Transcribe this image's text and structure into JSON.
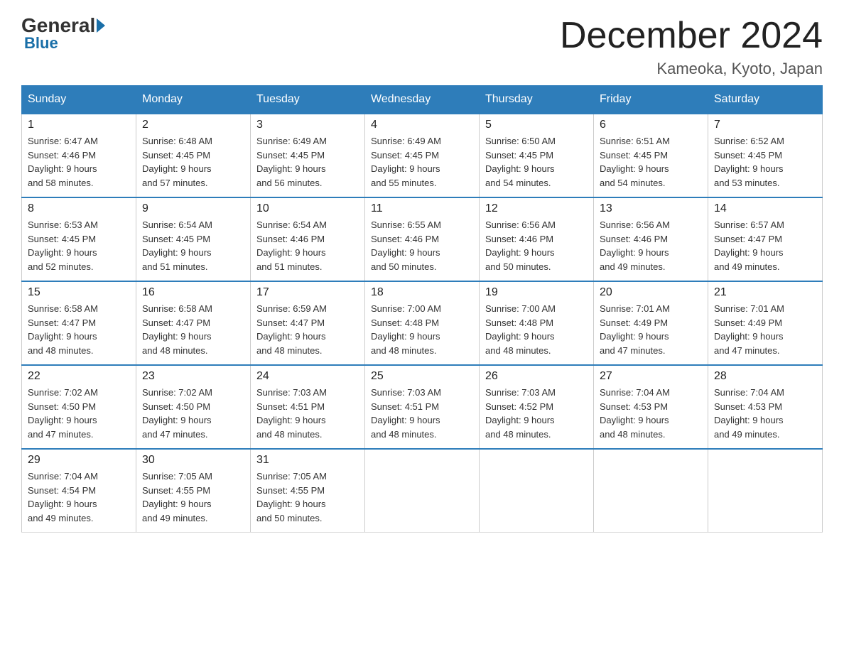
{
  "logo": {
    "general": "General",
    "blue": "Blue"
  },
  "title": "December 2024",
  "location": "Kameoka, Kyoto, Japan",
  "days_of_week": [
    "Sunday",
    "Monday",
    "Tuesday",
    "Wednesday",
    "Thursday",
    "Friday",
    "Saturday"
  ],
  "weeks": [
    [
      {
        "day": "1",
        "sunrise": "6:47 AM",
        "sunset": "4:46 PM",
        "daylight": "9 hours and 58 minutes."
      },
      {
        "day": "2",
        "sunrise": "6:48 AM",
        "sunset": "4:45 PM",
        "daylight": "9 hours and 57 minutes."
      },
      {
        "day": "3",
        "sunrise": "6:49 AM",
        "sunset": "4:45 PM",
        "daylight": "9 hours and 56 minutes."
      },
      {
        "day": "4",
        "sunrise": "6:49 AM",
        "sunset": "4:45 PM",
        "daylight": "9 hours and 55 minutes."
      },
      {
        "day": "5",
        "sunrise": "6:50 AM",
        "sunset": "4:45 PM",
        "daylight": "9 hours and 54 minutes."
      },
      {
        "day": "6",
        "sunrise": "6:51 AM",
        "sunset": "4:45 PM",
        "daylight": "9 hours and 54 minutes."
      },
      {
        "day": "7",
        "sunrise": "6:52 AM",
        "sunset": "4:45 PM",
        "daylight": "9 hours and 53 minutes."
      }
    ],
    [
      {
        "day": "8",
        "sunrise": "6:53 AM",
        "sunset": "4:45 PM",
        "daylight": "9 hours and 52 minutes."
      },
      {
        "day": "9",
        "sunrise": "6:54 AM",
        "sunset": "4:45 PM",
        "daylight": "9 hours and 51 minutes."
      },
      {
        "day": "10",
        "sunrise": "6:54 AM",
        "sunset": "4:46 PM",
        "daylight": "9 hours and 51 minutes."
      },
      {
        "day": "11",
        "sunrise": "6:55 AM",
        "sunset": "4:46 PM",
        "daylight": "9 hours and 50 minutes."
      },
      {
        "day": "12",
        "sunrise": "6:56 AM",
        "sunset": "4:46 PM",
        "daylight": "9 hours and 50 minutes."
      },
      {
        "day": "13",
        "sunrise": "6:56 AM",
        "sunset": "4:46 PM",
        "daylight": "9 hours and 49 minutes."
      },
      {
        "day": "14",
        "sunrise": "6:57 AM",
        "sunset": "4:47 PM",
        "daylight": "9 hours and 49 minutes."
      }
    ],
    [
      {
        "day": "15",
        "sunrise": "6:58 AM",
        "sunset": "4:47 PM",
        "daylight": "9 hours and 48 minutes."
      },
      {
        "day": "16",
        "sunrise": "6:58 AM",
        "sunset": "4:47 PM",
        "daylight": "9 hours and 48 minutes."
      },
      {
        "day": "17",
        "sunrise": "6:59 AM",
        "sunset": "4:47 PM",
        "daylight": "9 hours and 48 minutes."
      },
      {
        "day": "18",
        "sunrise": "7:00 AM",
        "sunset": "4:48 PM",
        "daylight": "9 hours and 48 minutes."
      },
      {
        "day": "19",
        "sunrise": "7:00 AM",
        "sunset": "4:48 PM",
        "daylight": "9 hours and 48 minutes."
      },
      {
        "day": "20",
        "sunrise": "7:01 AM",
        "sunset": "4:49 PM",
        "daylight": "9 hours and 47 minutes."
      },
      {
        "day": "21",
        "sunrise": "7:01 AM",
        "sunset": "4:49 PM",
        "daylight": "9 hours and 47 minutes."
      }
    ],
    [
      {
        "day": "22",
        "sunrise": "7:02 AM",
        "sunset": "4:50 PM",
        "daylight": "9 hours and 47 minutes."
      },
      {
        "day": "23",
        "sunrise": "7:02 AM",
        "sunset": "4:50 PM",
        "daylight": "9 hours and 47 minutes."
      },
      {
        "day": "24",
        "sunrise": "7:03 AM",
        "sunset": "4:51 PM",
        "daylight": "9 hours and 48 minutes."
      },
      {
        "day": "25",
        "sunrise": "7:03 AM",
        "sunset": "4:51 PM",
        "daylight": "9 hours and 48 minutes."
      },
      {
        "day": "26",
        "sunrise": "7:03 AM",
        "sunset": "4:52 PM",
        "daylight": "9 hours and 48 minutes."
      },
      {
        "day": "27",
        "sunrise": "7:04 AM",
        "sunset": "4:53 PM",
        "daylight": "9 hours and 48 minutes."
      },
      {
        "day": "28",
        "sunrise": "7:04 AM",
        "sunset": "4:53 PM",
        "daylight": "9 hours and 49 minutes."
      }
    ],
    [
      {
        "day": "29",
        "sunrise": "7:04 AM",
        "sunset": "4:54 PM",
        "daylight": "9 hours and 49 minutes."
      },
      {
        "day": "30",
        "sunrise": "7:05 AM",
        "sunset": "4:55 PM",
        "daylight": "9 hours and 49 minutes."
      },
      {
        "day": "31",
        "sunrise": "7:05 AM",
        "sunset": "4:55 PM",
        "daylight": "9 hours and 50 minutes."
      },
      null,
      null,
      null,
      null
    ]
  ]
}
